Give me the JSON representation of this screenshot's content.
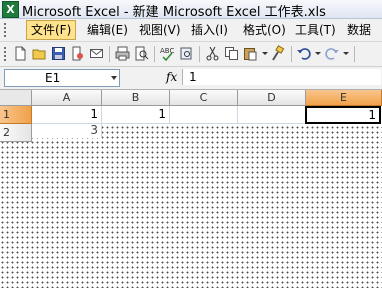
{
  "window": {
    "title": "Microsoft Excel - 新建 Microsoft Excel 工作表.xls",
    "app_icon_letter": "X"
  },
  "menu": {
    "items": [
      {
        "label": "文件(F)",
        "active": true
      },
      {
        "label": "编辑(E)"
      },
      {
        "label": "视图(V)"
      },
      {
        "label": "插入(I)"
      },
      {
        "label": "格式(O)"
      },
      {
        "label": "工具(T)"
      },
      {
        "label": "数据"
      }
    ]
  },
  "toolbar": {
    "icons": [
      "new-icon",
      "open-icon",
      "save-icon",
      "permission-icon",
      "email-icon",
      "print-icon",
      "print-preview-icon",
      "spelling-icon",
      "research-icon",
      "cut-icon",
      "copy-icon",
      "paste-icon",
      "format-painter-icon",
      "undo-icon",
      "redo-icon"
    ]
  },
  "formula_bar": {
    "name_box": "E1",
    "fx_label": "fx",
    "formula": "1"
  },
  "sheet": {
    "columns": [
      "A",
      "B",
      "C",
      "D",
      "E"
    ],
    "selected_column": "E",
    "rows": [
      {
        "header": "1",
        "cells": {
          "A": "1",
          "B": "1",
          "E": "1"
        },
        "selected": true
      },
      {
        "header": "2",
        "cells": {
          "A": "3"
        },
        "selected": false
      }
    ],
    "active_cell": "E1"
  },
  "colors": {
    "selection_header": "#f0a24a",
    "gridline": "#d0d7e5"
  }
}
